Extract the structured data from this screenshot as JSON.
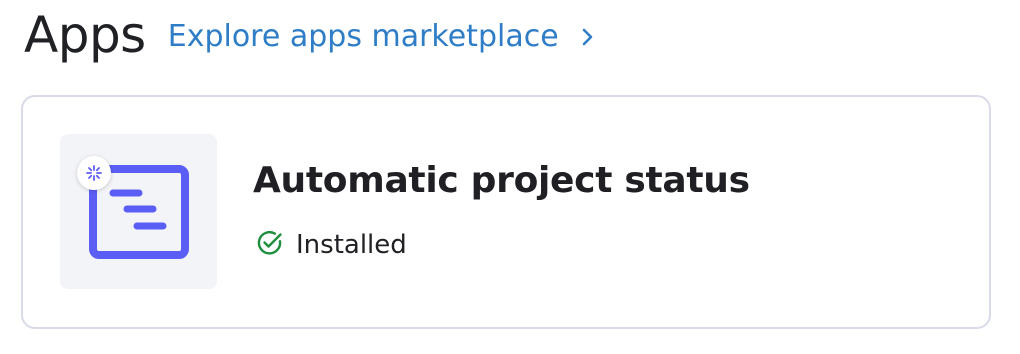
{
  "header": {
    "title": "Apps",
    "link_label": "Explore apps marketplace",
    "link_icon": "chevron-right-icon"
  },
  "app_card": {
    "name": "Automatic project status",
    "status_label": "Installed",
    "status_icon": "check-circle-icon",
    "app_icon": "project-status-icon",
    "badge_icon": "ai-sparkle-icon"
  },
  "colors": {
    "link": "#2e7dc6",
    "accent": "#5b5ef4",
    "installed": "#1e8e3e",
    "card_border": "#d9dbe8",
    "icon_tile": "#f3f4f8"
  }
}
